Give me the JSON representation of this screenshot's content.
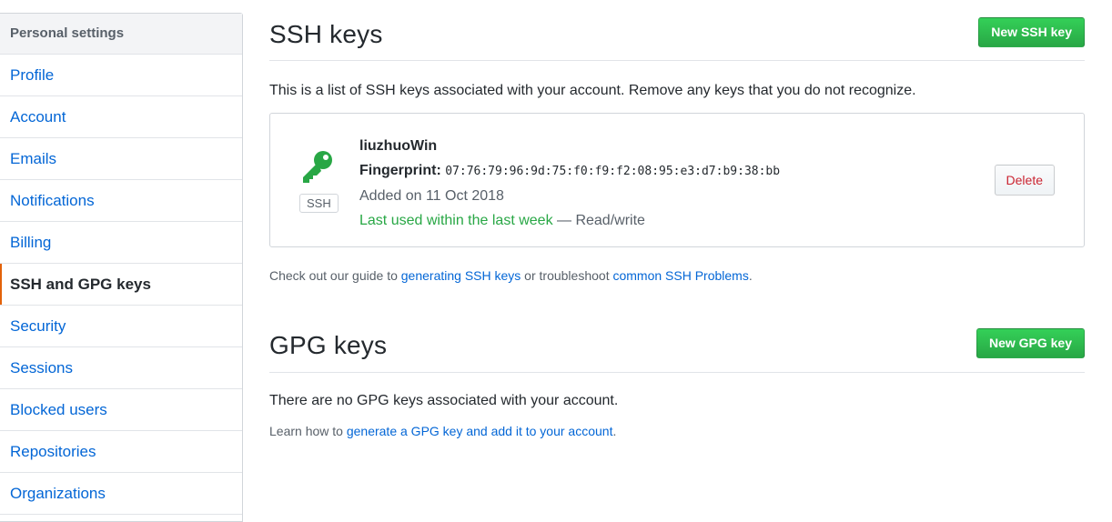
{
  "sidebar": {
    "header": "Personal settings",
    "items": [
      {
        "label": "Profile"
      },
      {
        "label": "Account"
      },
      {
        "label": "Emails"
      },
      {
        "label": "Notifications"
      },
      {
        "label": "Billing"
      },
      {
        "label": "SSH and GPG keys",
        "selected": true
      },
      {
        "label": "Security"
      },
      {
        "label": "Sessions"
      },
      {
        "label": "Blocked users"
      },
      {
        "label": "Repositories"
      },
      {
        "label": "Organizations"
      }
    ]
  },
  "ssh": {
    "title": "SSH keys",
    "new_button": "New SSH key",
    "intro": "This is a list of SSH keys associated with your account. Remove any keys that you do not recognize.",
    "key": {
      "icon": "key-icon",
      "type_label": "SSH",
      "title": "liuzhuoWin",
      "fingerprint_label": "Fingerprint:",
      "fingerprint": "07:76:79:96:9d:75:f0:f9:f2:08:95:e3:d7:b9:38:bb",
      "added": "Added on 11 Oct 2018",
      "last_used": "Last used within the last week",
      "access": " — Read/write",
      "delete_button": "Delete"
    },
    "guide": {
      "prefix": "Check out our guide to ",
      "link1": "generating SSH keys",
      "middle": " or troubleshoot ",
      "link2": "common SSH Problems",
      "suffix": "."
    }
  },
  "gpg": {
    "title": "GPG keys",
    "new_button": "New GPG key",
    "empty": "There are no GPG keys associated with your account.",
    "learn": {
      "prefix": "Learn how to ",
      "link": "generate a GPG key and add it to your account",
      "suffix": "."
    }
  },
  "colors": {
    "link": "#0366d6",
    "green": "#28a745",
    "danger": "#cb2431",
    "selected_accent": "#e36209"
  }
}
